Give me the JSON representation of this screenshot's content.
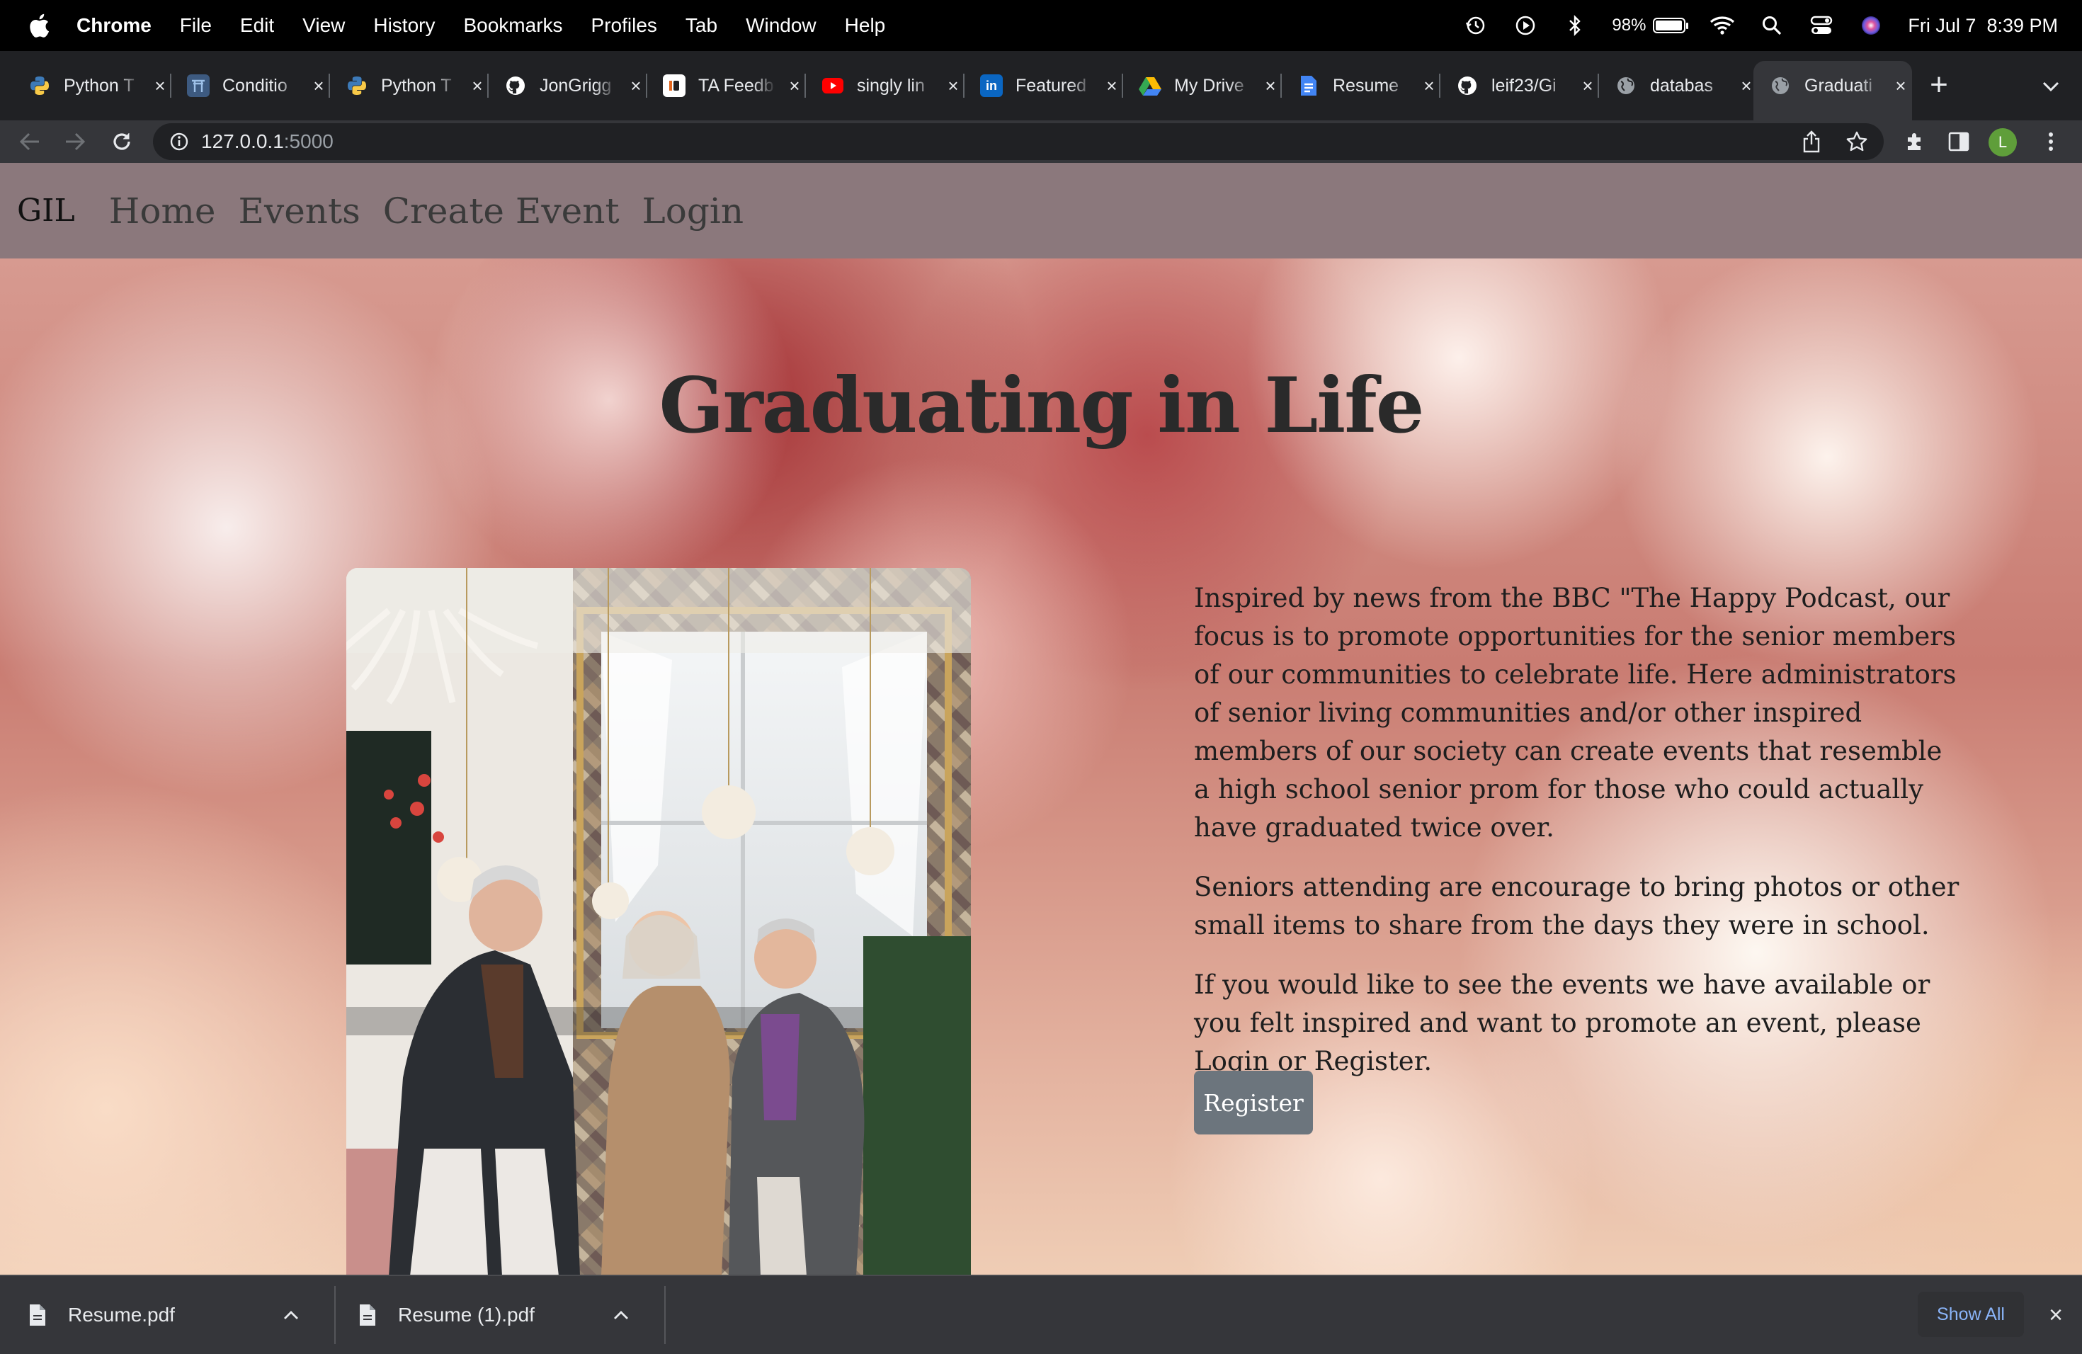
{
  "menubar": {
    "app_name": "Chrome",
    "items": [
      "File",
      "Edit",
      "View",
      "History",
      "Bookmarks",
      "Profiles",
      "Tab",
      "Window",
      "Help"
    ],
    "battery": "98%",
    "datetime": "Fri Jul 7  8:39 PM"
  },
  "tabs": [
    {
      "title": "Python T",
      "icon": "python-icon",
      "color": "#3776ab"
    },
    {
      "title": "Conditio",
      "icon": "torii-icon",
      "color": "#4a6fa5"
    },
    {
      "title": "Python T",
      "icon": "python-icon",
      "color": "#3776ab"
    },
    {
      "title": "JonGrigg",
      "icon": "github-icon",
      "color": "#ffffff"
    },
    {
      "title": "TA Feedb",
      "icon": "ta-icon",
      "color": "#ffffff"
    },
    {
      "title": "singly lin",
      "icon": "youtube-icon",
      "color": "#ff0000"
    },
    {
      "title": "Featured",
      "icon": "linkedin-icon",
      "color": "#0a66c2"
    },
    {
      "title": "My Drive",
      "icon": "drive-icon",
      "color": "#34a853"
    },
    {
      "title": "Resume",
      "icon": "docs-icon",
      "color": "#4285f4"
    },
    {
      "title": "leif23/Gi",
      "icon": "github-icon",
      "color": "#ffffff"
    },
    {
      "title": "databas",
      "icon": "globe-icon",
      "color": "#9aa0a6"
    },
    {
      "title": "Graduati",
      "icon": "globe-icon",
      "color": "#9aa0a6",
      "active": true
    }
  ],
  "toolbar": {
    "url_host": "127.0.0.1",
    "url_port": ":5000",
    "avatar_letter": "L"
  },
  "site": {
    "brand": "GIL",
    "nav": [
      "Home",
      "Events",
      "Create Event",
      "Login"
    ],
    "title": "Graduating in Life",
    "paragraphs": [
      "Inspired by news from the BBC \"The Happy Podcast, our focus is to promote opportunities for the senior members of our communities to celebrate life. Here administrators of senior living communities and/or other inspired members of our society can create events that resemble a high school senior prom for those who could actually have graduated twice over.",
      "Seniors attending are encourage to bring photos or other small items to share from the days they were in school.",
      "If you would like to see the events we have available or you felt inspired and want to promote an event, please Login or Register."
    ],
    "register_label": "Register"
  },
  "downloads": {
    "items": [
      "Resume.pdf",
      "Resume (1).pdf"
    ],
    "show_all": "Show All"
  }
}
